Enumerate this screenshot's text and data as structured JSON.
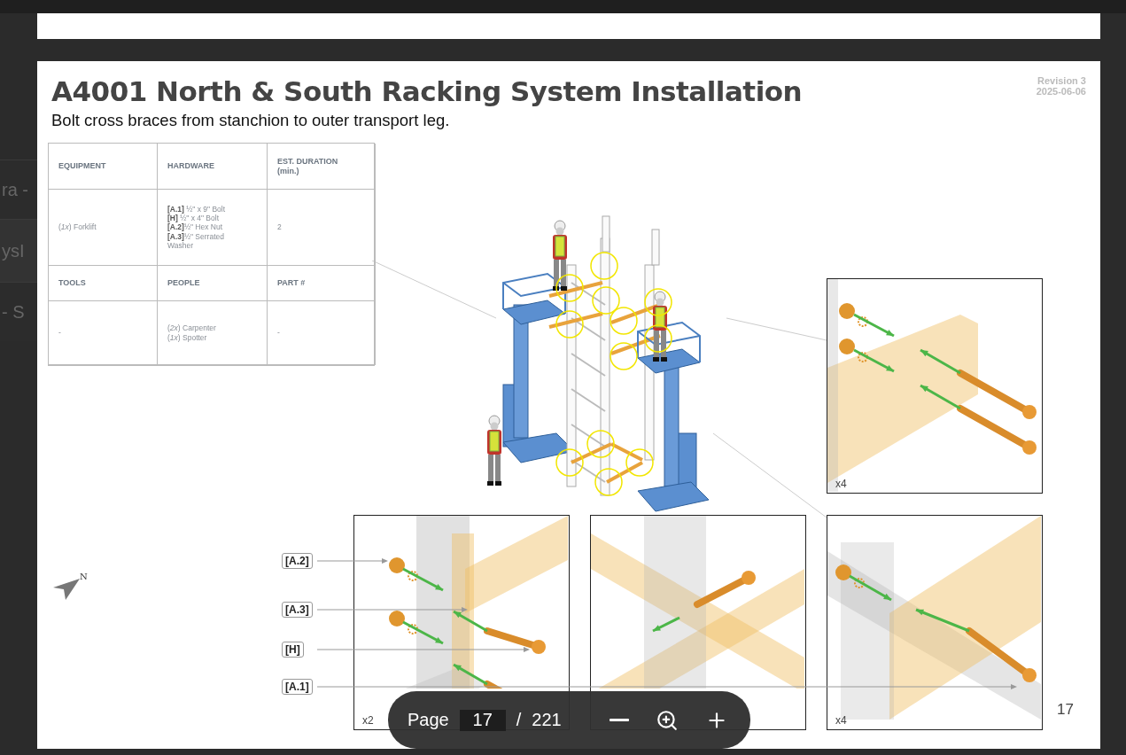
{
  "background": {
    "list_fragments": [
      "ra -",
      "ysI",
      "- S"
    ]
  },
  "page": {
    "title": "A4001 North & South Racking System Installation",
    "subtitle": "Bolt cross braces from stanchion to outer transport leg.",
    "revision": "Revision 3",
    "date": "2025-06-06",
    "table": {
      "rows": [
        {
          "kind": "header",
          "cells": [
            [
              "EQUIPMENT"
            ],
            [
              "HARDWARE"
            ],
            [
              "EST. DURATION",
              "(min.)"
            ]
          ]
        },
        {
          "kind": "body",
          "cells": [
            [
              "(*1x*) Forklift"
            ],
            [
              "**[A.1]** ½\" x 9\" Bolt",
              "**[H]** ½\" x 4\" Bolt",
              "**[A.2]**½\" Hex Nut",
              "**[A.3]**½\" Serrated",
              "Washer"
            ],
            [
              "2"
            ]
          ]
        },
        {
          "kind": "header",
          "cells": [
            [
              "TOOLS"
            ],
            [
              "PEOPLE"
            ],
            [
              "PART #"
            ]
          ]
        },
        {
          "kind": "body",
          "cells": [
            [
              "-"
            ],
            [
              "(*2x*) Carpenter",
              "(*1x*) Spotter"
            ],
            [
              "-"
            ]
          ]
        }
      ]
    },
    "callouts": [
      "[A.2]",
      "[A.3]",
      "[H]",
      "[A.1]"
    ],
    "north_label": "N",
    "detail_panels": [
      {
        "kind": "beam",
        "quantity": "x4"
      },
      {
        "kind": "upright",
        "quantity": "x2"
      },
      {
        "kind": "crossing"
      },
      {
        "kind": "leg",
        "quantity": "x4"
      }
    ],
    "page_number": "17"
  },
  "viewer": {
    "page_label": "Page",
    "current_page": "17",
    "separator": "/",
    "total_pages": "221"
  }
}
